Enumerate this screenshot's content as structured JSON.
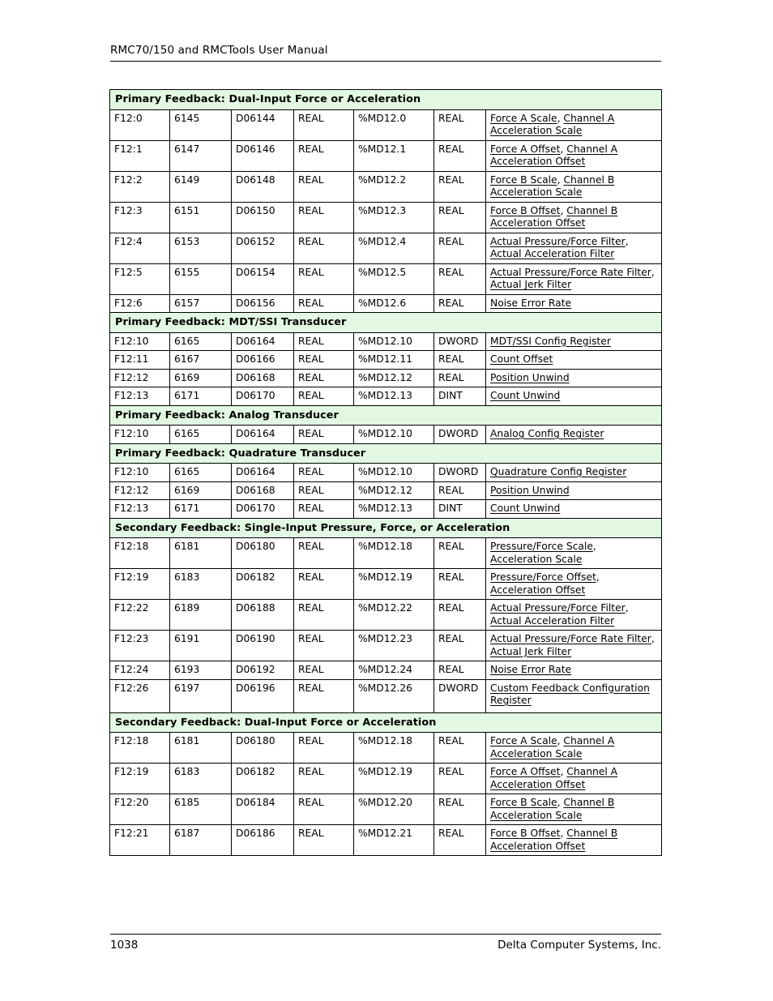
{
  "header": {
    "title": "RMC70/150 and RMCTools User Manual"
  },
  "footer": {
    "page_number": "1038",
    "company": "Delta Computer Systems, Inc."
  },
  "colors": {
    "section_header_bg": "#e2f8e2",
    "border": "#000000",
    "text": "#000000"
  },
  "table": {
    "columns": 7,
    "sections": [
      {
        "title": "Primary Feedback: Dual-Input Force or Acceleration",
        "rows": [
          {
            "c0": "F12:0",
            "c1": "6145",
            "c2": "D06144",
            "c3": "REAL",
            "c4": "%MD12.0",
            "c5": "REAL",
            "desc": [
              {
                "text": "Force A Scale",
                "link": true
              },
              {
                "text": ", ",
                "link": false
              },
              {
                "text": "Channel A Acceleration Scale",
                "link": true
              }
            ]
          },
          {
            "c0": "F12:1",
            "c1": "6147",
            "c2": "D06146",
            "c3": "REAL",
            "c4": "%MD12.1",
            "c5": "REAL",
            "desc": [
              {
                "text": "Force A Offset",
                "link": true
              },
              {
                "text": ", ",
                "link": false
              },
              {
                "text": "Channel A Acceleration Offset",
                "link": true
              }
            ]
          },
          {
            "c0": "F12:2",
            "c1": "6149",
            "c2": "D06148",
            "c3": "REAL",
            "c4": "%MD12.2",
            "c5": "REAL",
            "thick_top": true,
            "desc": [
              {
                "text": "Force B Scale",
                "link": true
              },
              {
                "text": ", ",
                "link": false
              },
              {
                "text": "Channel B Acceleration Scale",
                "link": true
              }
            ]
          },
          {
            "c0": "F12:3",
            "c1": "6151",
            "c2": "D06150",
            "c3": "REAL",
            "c4": "%MD12.3",
            "c5": "REAL",
            "desc": [
              {
                "text": "Force B Offset",
                "link": true
              },
              {
                "text": ", ",
                "link": false
              },
              {
                "text": "Channel B Acceleration Offset",
                "link": true
              }
            ]
          },
          {
            "c0": "F12:4",
            "c1": "6153",
            "c2": "D06152",
            "c3": "REAL",
            "c4": "%MD12.4",
            "c5": "REAL",
            "thick_top": true,
            "desc": [
              {
                "text": "Actual Pressure/Force Filter",
                "link": true
              },
              {
                "text": ", ",
                "link": false
              },
              {
                "text": "Actual Acceleration Filter",
                "link": true
              }
            ]
          },
          {
            "c0": "F12:5",
            "c1": "6155",
            "c2": "D06154",
            "c3": "REAL",
            "c4": "%MD12.5",
            "c5": "REAL",
            "desc": [
              {
                "text": "Actual Pressure/Force Rate Filter",
                "link": true
              },
              {
                "text": ", ",
                "link": false
              },
              {
                "text": "Actual Jerk Filter",
                "link": true
              }
            ]
          },
          {
            "c0": "F12:6",
            "c1": "6157",
            "c2": "D06156",
            "c3": "REAL",
            "c4": "%MD12.6",
            "c5": "REAL",
            "desc": [
              {
                "text": "Noise Error Rate",
                "link": true
              }
            ]
          }
        ]
      },
      {
        "title": "Primary Feedback: MDT/SSI Transducer",
        "rows": [
          {
            "c0": "F12:10",
            "c1": "6165",
            "c2": "D06164",
            "c3": "REAL",
            "c4": "%MD12.10",
            "c5": "DWORD",
            "desc": [
              {
                "text": "MDT/SSI Config Register",
                "link": true
              }
            ]
          },
          {
            "c0": "F12:11",
            "c1": "6167",
            "c2": "D06166",
            "c3": "REAL",
            "c4": "%MD12.11",
            "c5": "REAL",
            "desc": [
              {
                "text": "Count Offset",
                "link": true
              }
            ]
          },
          {
            "c0": "F12:12",
            "c1": "6169",
            "c2": "D06168",
            "c3": "REAL",
            "c4": "%MD12.12",
            "c5": "REAL",
            "desc": [
              {
                "text": "Position Unwind",
                "link": true
              }
            ]
          },
          {
            "c0": "F12:13",
            "c1": "6171",
            "c2": "D06170",
            "c3": "REAL",
            "c4": "%MD12.13",
            "c5": "DINT",
            "desc": [
              {
                "text": "Count Unwind",
                "link": true
              }
            ]
          }
        ]
      },
      {
        "title": "Primary Feedback: Analog Transducer",
        "rows": [
          {
            "c0": "F12:10",
            "c1": "6165",
            "c2": "D06164",
            "c3": "REAL",
            "c4": "%MD12.10",
            "c5": "DWORD",
            "desc": [
              {
                "text": "Analog Config Register",
                "link": true
              }
            ]
          }
        ]
      },
      {
        "title": "Primary Feedback: Quadrature Transducer",
        "rows": [
          {
            "c0": "F12:10",
            "c1": "6165",
            "c2": "D06164",
            "c3": "REAL",
            "c4": "%MD12.10",
            "c5": "DWORD",
            "desc": [
              {
                "text": "Quadrature Config Register",
                "link": true
              }
            ]
          },
          {
            "c0": "F12:12",
            "c1": "6169",
            "c2": "D06168",
            "c3": "REAL",
            "c4": "%MD12.12",
            "c5": "REAL",
            "desc": [
              {
                "text": "Position Unwind",
                "link": true
              }
            ]
          },
          {
            "c0": "F12:13",
            "c1": "6171",
            "c2": "D06170",
            "c3": "REAL",
            "c4": "%MD12.13",
            "c5": "DINT",
            "desc": [
              {
                "text": "Count Unwind",
                "link": true
              }
            ]
          }
        ]
      },
      {
        "title": "Secondary Feedback: Single-Input Pressure, Force, or Acceleration",
        "rows": [
          {
            "c0": "F12:18",
            "c1": "6181",
            "c2": "D06180",
            "c3": "REAL",
            "c4": "%MD12.18",
            "c5": "REAL",
            "desc": [
              {
                "text": "Pressure/Force Scale",
                "link": true
              },
              {
                "text": ", ",
                "link": false
              },
              {
                "text": "Acceleration Scale",
                "link": true
              }
            ]
          },
          {
            "c0": "F12:19",
            "c1": "6183",
            "c2": "D06182",
            "c3": "REAL",
            "c4": "%MD12.19",
            "c5": "REAL",
            "desc": [
              {
                "text": "Pressure/Force Offset",
                "link": true
              },
              {
                "text": ", ",
                "link": false
              },
              {
                "text": "Acceleration Offset",
                "link": true
              }
            ]
          },
          {
            "c0": "F12:22",
            "c1": "6189",
            "c2": "D06188",
            "c3": "REAL",
            "c4": "%MD12.22",
            "c5": "REAL",
            "thick_top": true,
            "desc": [
              {
                "text": "Actual Pressure/Force Filter",
                "link": true
              },
              {
                "text": ", ",
                "link": false
              },
              {
                "text": "Actual Acceleration Filter",
                "link": true
              }
            ]
          },
          {
            "c0": "F12:23",
            "c1": "6191",
            "c2": "D06190",
            "c3": "REAL",
            "c4": "%MD12.23",
            "c5": "REAL",
            "desc": [
              {
                "text": "Actual Pressure/Force Rate Filter",
                "link": true
              },
              {
                "text": ", ",
                "link": false
              },
              {
                "text": "Actual Jerk Filter",
                "link": true
              }
            ]
          },
          {
            "c0": "F12:24",
            "c1": "6193",
            "c2": "D06192",
            "c3": "REAL",
            "c4": "%MD12.24",
            "c5": "REAL",
            "desc": [
              {
                "text": "Noise Error Rate",
                "link": true
              }
            ]
          },
          {
            "c0": "F12:26",
            "c1": "6197",
            "c2": "D06196",
            "c3": "REAL",
            "c4": "%MD12.26",
            "c5": "DWORD",
            "thick_top": true,
            "tall": true,
            "desc": [
              {
                "text": "Custom Feedback Configuration Register",
                "link": true
              }
            ]
          }
        ]
      },
      {
        "title": "Secondary Feedback: Dual-Input Force or Acceleration",
        "rows": [
          {
            "c0": "F12:18",
            "c1": "6181",
            "c2": "D06180",
            "c3": "REAL",
            "c4": "%MD12.18",
            "c5": "REAL",
            "desc": [
              {
                "text": "Force A Scale",
                "link": true
              },
              {
                "text": ", ",
                "link": false
              },
              {
                "text": "Channel A Acceleration Scale",
                "link": true
              }
            ]
          },
          {
            "c0": "F12:19",
            "c1": "6183",
            "c2": "D06182",
            "c3": "REAL",
            "c4": "%MD12.19",
            "c5": "REAL",
            "desc": [
              {
                "text": "Force A Offset",
                "link": true
              },
              {
                "text": ", ",
                "link": false
              },
              {
                "text": "Channel A Acceleration Offset",
                "link": true
              }
            ]
          },
          {
            "c0": "F12:20",
            "c1": "6185",
            "c2": "D06184",
            "c3": "REAL",
            "c4": "%MD12.20",
            "c5": "REAL",
            "thick_top": true,
            "desc": [
              {
                "text": "Force B Scale",
                "link": true
              },
              {
                "text": ", ",
                "link": false
              },
              {
                "text": "Channel B Acceleration Scale",
                "link": true
              }
            ]
          },
          {
            "c0": "F12:21",
            "c1": "6187",
            "c2": "D06186",
            "c3": "REAL",
            "c4": "%MD12.21",
            "c5": "REAL",
            "desc": [
              {
                "text": "Force B Offset",
                "link": true
              },
              {
                "text": ", ",
                "link": false
              },
              {
                "text": "Channel B Acceleration Offset",
                "link": true
              }
            ]
          }
        ]
      }
    ]
  }
}
